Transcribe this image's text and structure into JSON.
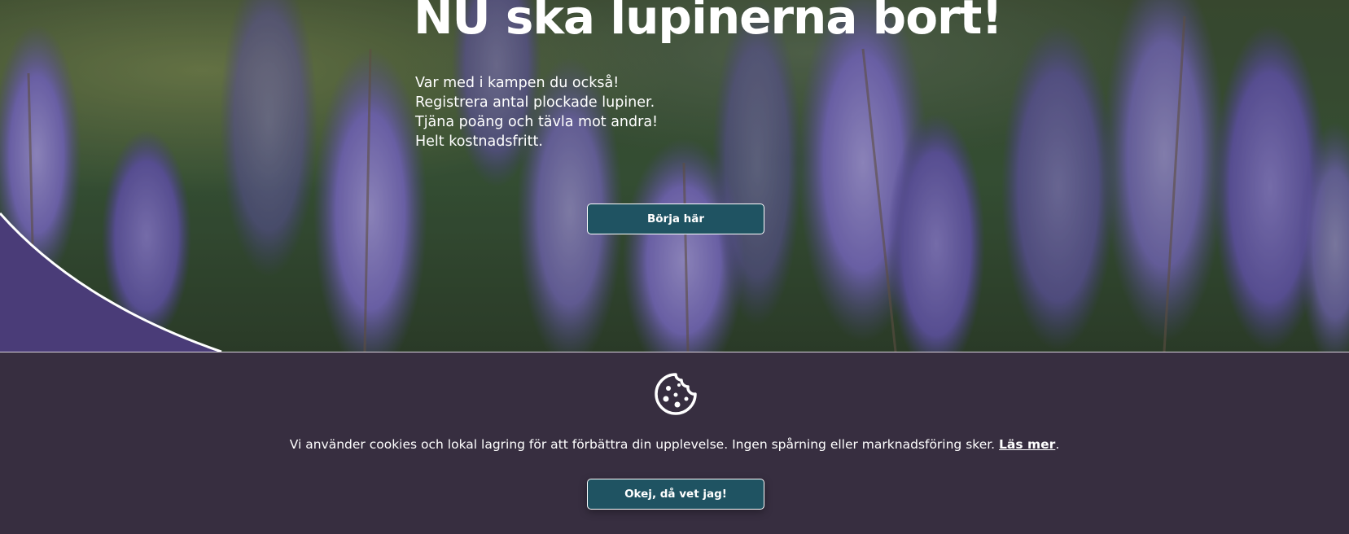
{
  "hero": {
    "title": "NU ska lupinerna bort!",
    "lines": [
      "Var med i kampen du också!",
      "Registrera antal plockade lupiner.",
      "Tjäna poäng och tävla mot andra!",
      "Helt kostnadsfritt."
    ],
    "start_button_label": "Börja här"
  },
  "cookie_banner": {
    "message": "Vi använder cookies och lokal lagring för att förbättra din upplevelse. Ingen spårning eller marknadsföring sker.",
    "read_more_label": "Läs mer",
    "message_end": ".",
    "accept_button_label": "Okej, då vet jag!",
    "icon": "cookie-icon"
  },
  "colors": {
    "button_bg": "#1f5362",
    "banner_bg": "#372e40",
    "corner_purple": "#4a3c78"
  }
}
